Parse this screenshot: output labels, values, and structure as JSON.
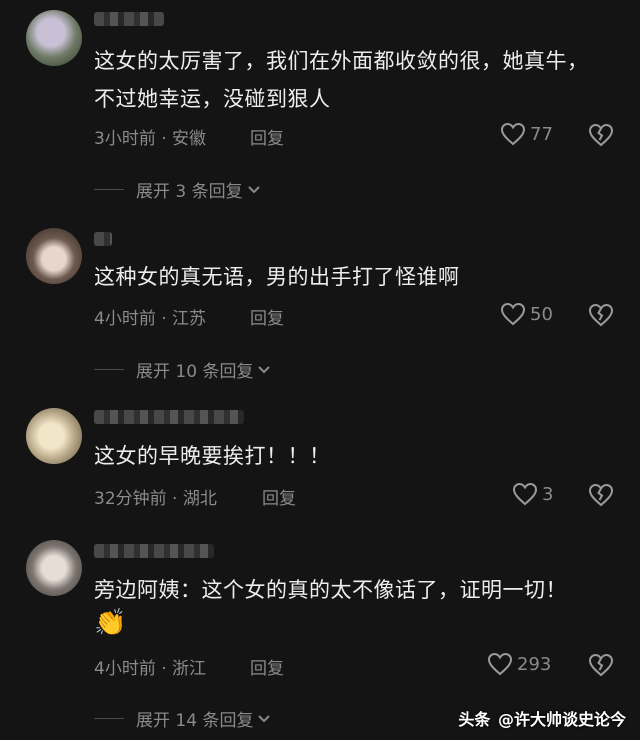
{
  "comments": [
    {
      "text": "这女的太厉害了，我们在外面都收敛的很，她真牛，\n不过她幸运，没碰到狠人",
      "meta": "3小时前 · 安徽",
      "reply_label": "回复",
      "likes": "77",
      "expand": "展开 3 条回复"
    },
    {
      "text": "这种女的真无语，男的出手打了怪谁啊",
      "meta": "4小时前 · 江苏",
      "reply_label": "回复",
      "likes": "50",
      "expand": "展开 10 条回复"
    },
    {
      "text": "这女的早晚要挨打！！！",
      "meta": "32分钟前 · 湖北",
      "reply_label": "回复",
      "likes": "3"
    },
    {
      "text": "旁边阿姨：这个女的真的太不像话了，证明一切！",
      "emoji": "👏",
      "meta": "4小时前 · 浙江",
      "reply_label": "回复",
      "likes": "293",
      "expand": "展开 14 条回复"
    }
  ],
  "watermark": {
    "brand": "头条",
    "handle": "@许大帅谈史论今"
  },
  "colors": {
    "background": "#141414",
    "text": "#ededed",
    "muted": "#8a8a8a"
  }
}
